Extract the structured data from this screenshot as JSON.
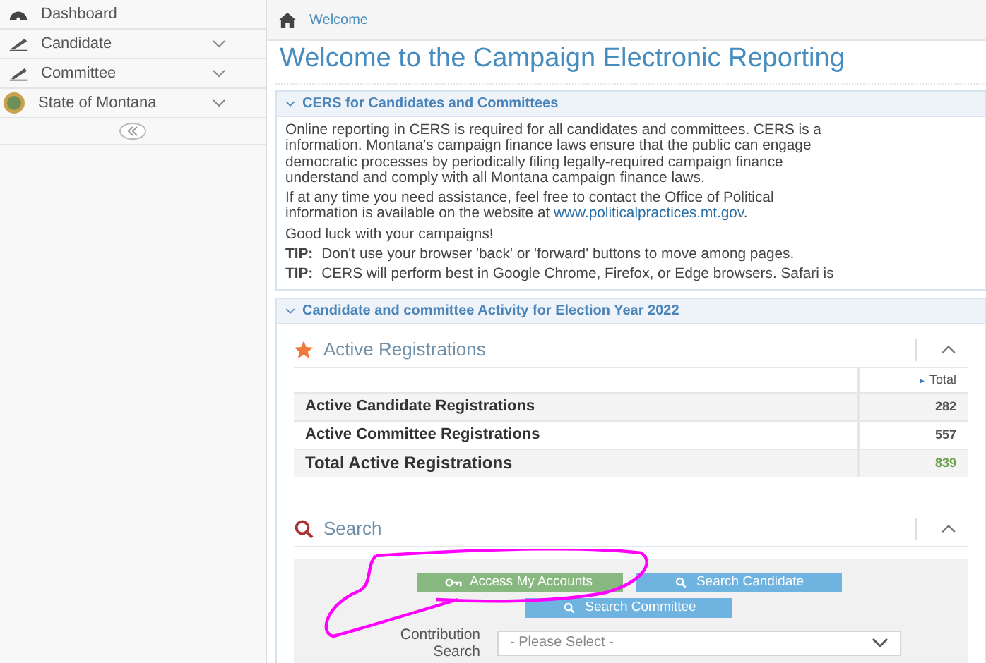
{
  "sidebar": {
    "items": [
      {
        "label": "Dashboard",
        "expandable": false
      },
      {
        "label": "Candidate",
        "expandable": true
      },
      {
        "label": "Committee",
        "expandable": true
      },
      {
        "label": "State of Montana",
        "expandable": true
      }
    ]
  },
  "breadcrumb": "Welcome",
  "page_title": "Welcome to the Campaign Electronic Reporting",
  "info_panel": {
    "title": "CERS for Candidates and Committees",
    "paragraphs": [
      {
        "lines": [
          "Online reporting in CERS is required for all candidates and committees. CERS is a",
          "information. Montana's campaign finance laws ensure that the public can engage",
          "democratic processes by periodically filing legally-required campaign finance",
          "understand and comply with all Montana campaign finance laws."
        ]
      },
      {
        "lines": [
          "If at any time you need assistance, feel free to contact the Office of Political",
          "information is available on the website at"
        ],
        "link": "www.politicalpractices.mt.gov",
        "after_link": "."
      },
      {
        "lines": [
          "Good luck with your campaigns!"
        ]
      }
    ],
    "tips": [
      {
        "label": "TIP:",
        "text": "Don't use your browser 'back' or 'forward' buttons to move among pages."
      },
      {
        "label": "TIP:",
        "text": "CERS will perform best in Google Chrome, Firefox, or Edge browsers. Safari is"
      }
    ]
  },
  "activity_panel": {
    "title": "Candidate and committee Activity for Election Year 2022",
    "registrations": {
      "title": "Active Registrations",
      "column_marker": "▸",
      "column": "Total",
      "rows": [
        {
          "label": "Active Candidate Registrations",
          "value": "282",
          "kind": "normal"
        },
        {
          "label": "Active Committee Registrations",
          "value": "557",
          "kind": "normal"
        },
        {
          "label": "Total Active Registrations",
          "value": "839",
          "kind": "total"
        }
      ]
    },
    "search": {
      "title": "Search",
      "buttons": [
        {
          "label": "Access My Accounts",
          "kind": "green"
        },
        {
          "label": "Search Candidate",
          "kind": "blue"
        },
        {
          "label": "Search Committee",
          "kind": "blue"
        }
      ],
      "contribution_label": "Contribution Search",
      "select_placeholder": "- Please Select -"
    }
  }
}
